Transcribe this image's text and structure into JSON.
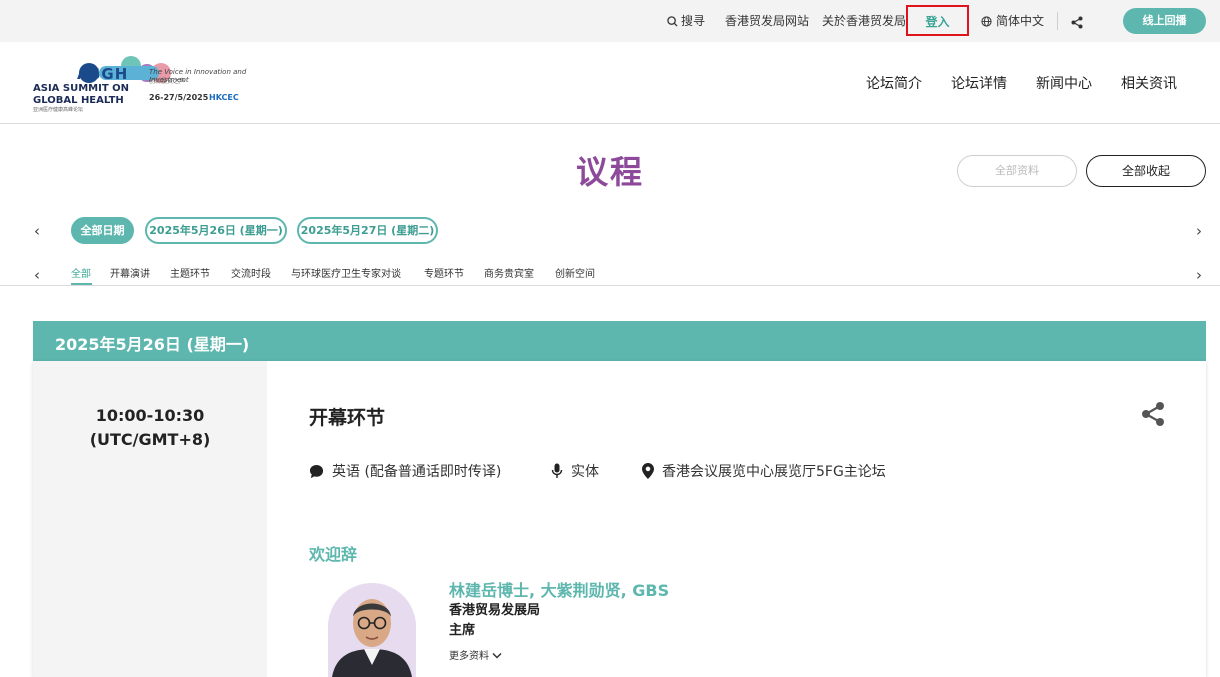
{
  "topbar": {
    "search_label": "搜寻",
    "tdc_site": "香港贸发局网站",
    "about": "关於香港贸发局",
    "login": "登入",
    "language": "简体中文",
    "live_button": "线上回播"
  },
  "logo": {
    "acronym": "ASGH",
    "line1": "ASIA SUMMIT ON",
    "line2": "GLOBAL HEALTH",
    "line3": "亚洲医疗健康高峰论坛",
    "tagline": "The Voice in Innovation and Investment",
    "tagline_cn": "创新投资之声",
    "dates": "26-27/5/2025",
    "venue": "HKCEC"
  },
  "nav": {
    "items": [
      "论坛简介",
      "论坛详情",
      "新闻中心",
      "相关资讯"
    ]
  },
  "page": {
    "title": "议程",
    "expand_all": "全部资料",
    "collapse_all": "全部收起"
  },
  "date_filters": {
    "items": [
      "全部日期",
      "2025年5月26日 (星期一)",
      "2025年5月27日 (星期二)"
    ]
  },
  "category_tabs": {
    "items": [
      "全部",
      "开幕演讲",
      "主题环节",
      "交流时段",
      "与环球医疗卫生专家对谈",
      "专题环节",
      "商务贵宾室",
      "创新空间"
    ]
  },
  "day_header": "2025年5月26日 (星期一)",
  "session": {
    "time": "10:00-10:30",
    "timezone": "(UTC/GMT+8)",
    "title": "开幕环节",
    "language": "英语 (配备普通话即时传译)",
    "format": "实体",
    "location": "香港会议展览中心展览厅5FG主论坛",
    "segment_title": "欢迎辞",
    "speaker": {
      "name": "林建岳博士, 大紫荆勋贤, GBS",
      "organization": "香港贸易发展局",
      "role": "主席",
      "more_label": "更多资料"
    }
  },
  "colors": {
    "accent": "#5db7ae",
    "title_purple": "#8d4a9b",
    "login_highlight": "#e0121b"
  },
  "icons": [
    "search-icon",
    "globe-icon",
    "share-icon",
    "chat-bubble-icon",
    "microphone-icon",
    "location-pin-icon",
    "chevron-left-icon",
    "chevron-right-icon",
    "chevron-down-icon"
  ]
}
